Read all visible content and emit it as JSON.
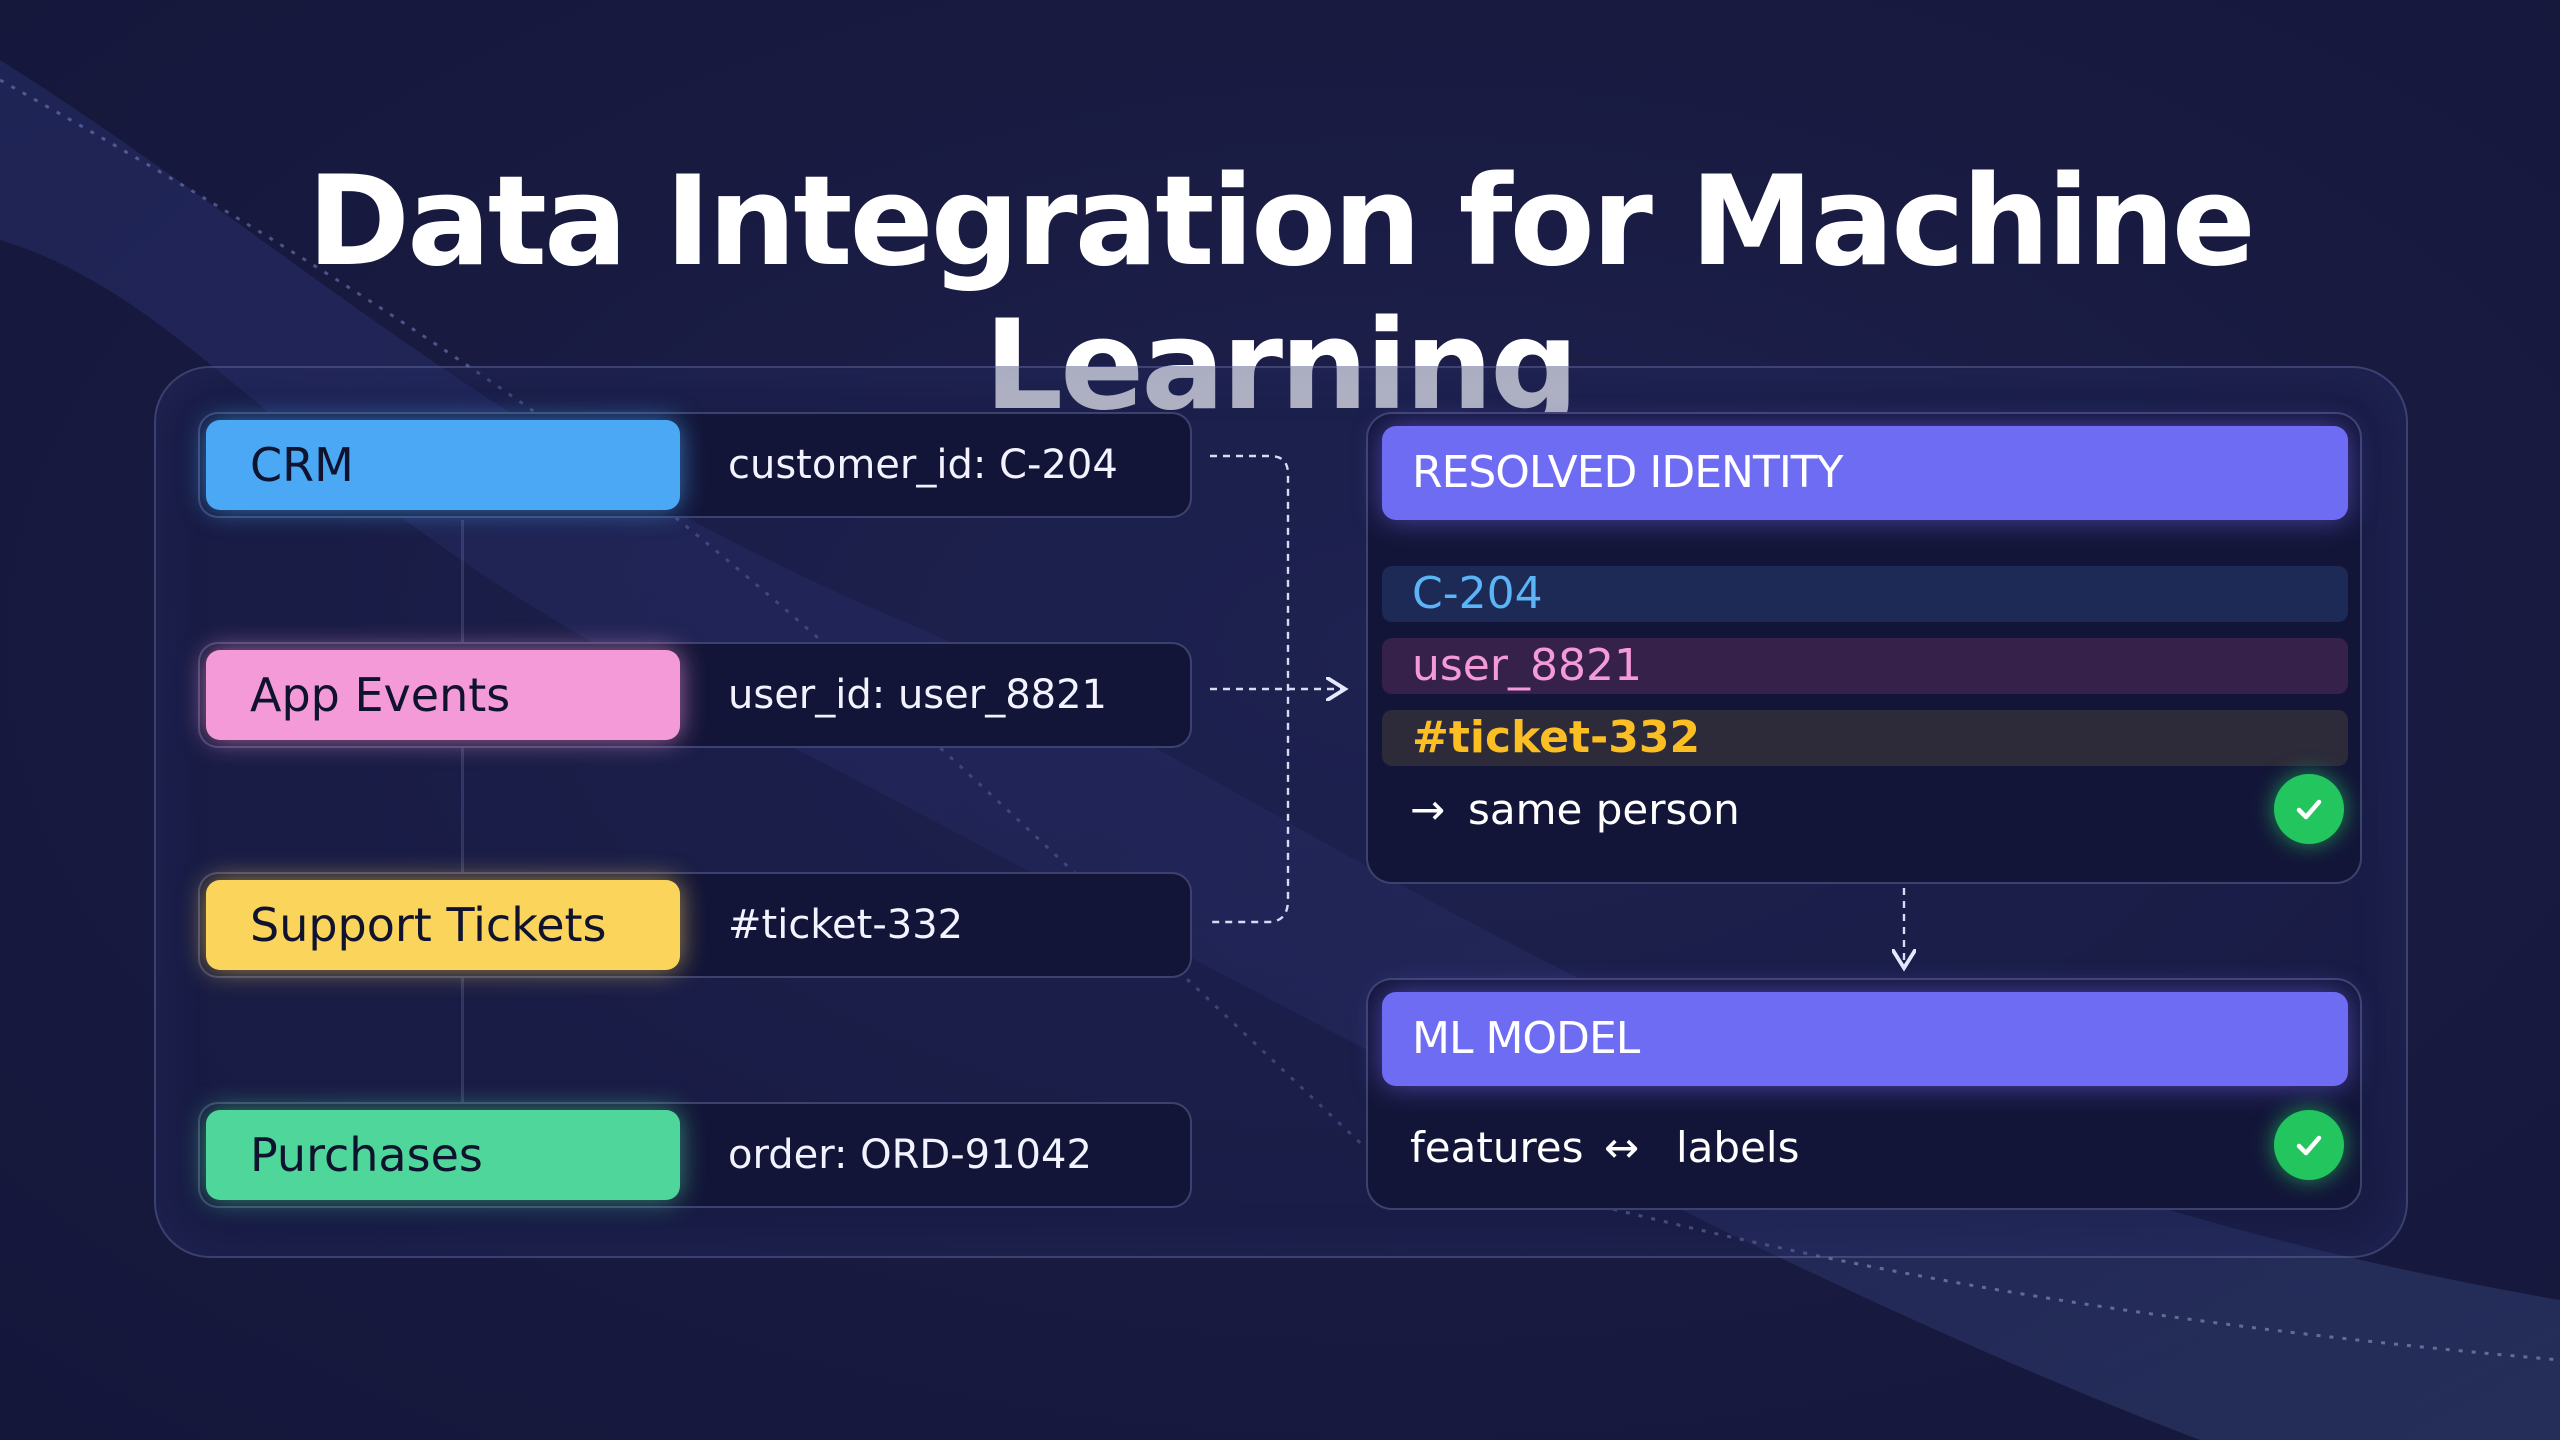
{
  "title": "Data Integration for Machine Learning",
  "sources": [
    {
      "label": "CRM",
      "identifier": "customer_id: C-204",
      "color": "#4aa8f5"
    },
    {
      "label": "App Events",
      "identifier": "user_id: user_8821",
      "color": "#f59ad9"
    },
    {
      "label": "Support Tickets",
      "identifier": "#ticket-332",
      "color": "#fbd45c"
    },
    {
      "label": "Purchases",
      "identifier": "order: ORD-91042",
      "color": "#4fd69a"
    }
  ],
  "resolved": {
    "header": "RESOLVED IDENTITY",
    "ids": [
      {
        "text": "C-204",
        "color": "#5ab4f5"
      },
      {
        "text": "user_8821",
        "color": "#f59ad9"
      },
      {
        "text": "#ticket-332",
        "color": "#fbbf24"
      }
    ],
    "result_arrow": "→",
    "result": "same person"
  },
  "model": {
    "header": "ML MODEL",
    "left": "features",
    "arrow": "↔",
    "right": "labels"
  },
  "icons": {
    "check": "check-icon"
  },
  "colors": {
    "accent": "#6e6cf2",
    "success": "#22c55e",
    "background": "#181a40"
  }
}
